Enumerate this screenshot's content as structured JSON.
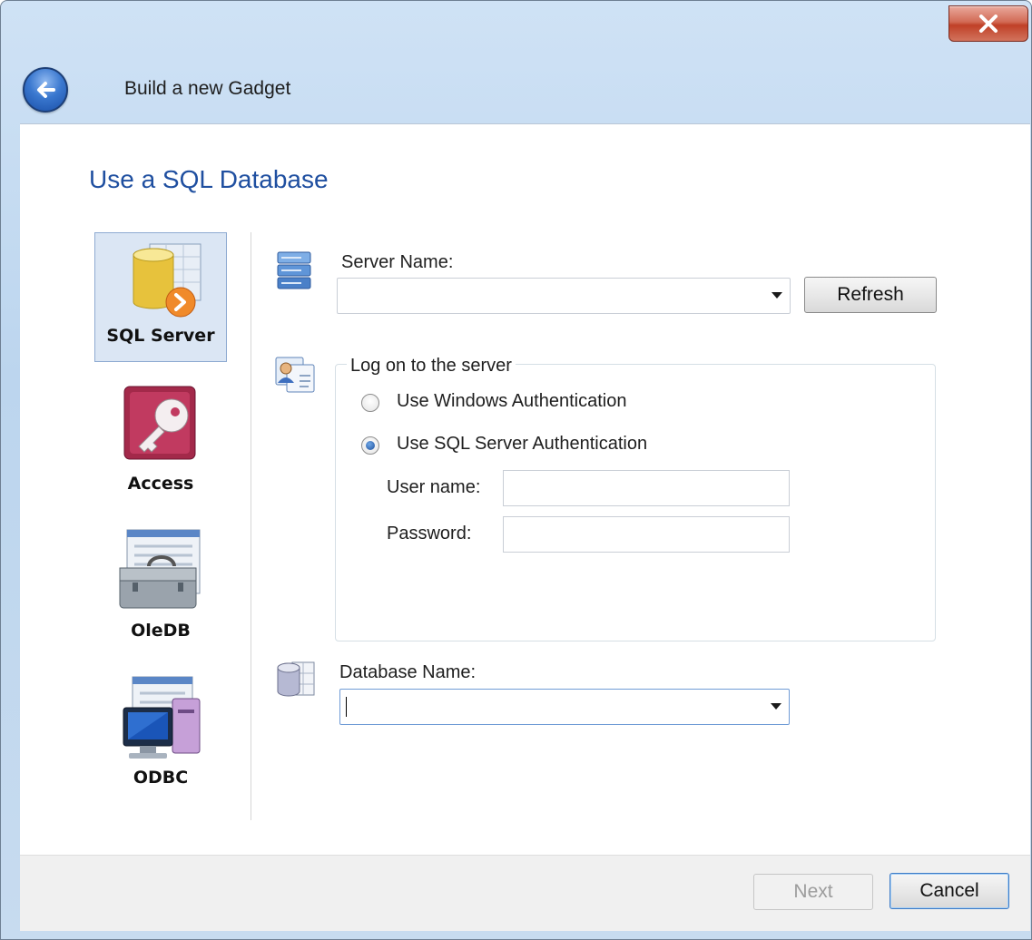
{
  "window": {
    "title": "Build a new Gadget",
    "close_glyph": "✕"
  },
  "page": {
    "heading": "Use a SQL Database"
  },
  "sources": [
    {
      "label": "SQL Server",
      "icon": "sql-server-icon",
      "selected": true
    },
    {
      "label": "Access",
      "icon": "access-key-icon",
      "selected": false
    },
    {
      "label": "OleDB",
      "icon": "toolbox-icon",
      "selected": false
    },
    {
      "label": "ODBC",
      "icon": "computer-icon",
      "selected": false
    }
  ],
  "server": {
    "label": "Server Name:",
    "value": "",
    "refresh_label": "Refresh",
    "icon": "server-stack-icon"
  },
  "logon": {
    "legend": "Log on to the server",
    "icon": "user-cards-icon",
    "windows_auth_label": "Use Windows Authentication",
    "sql_auth_label": "Use SQL Server Authentication",
    "selected": "sql",
    "username_label": "User name:",
    "username_value": "",
    "password_label": "Password:",
    "password_value": ""
  },
  "database": {
    "label": "Database Name:",
    "value": "",
    "icon": "database-table-icon"
  },
  "footer": {
    "next_label": "Next",
    "cancel_label": "Cancel"
  },
  "colors": {
    "heading": "#1f4fa0",
    "selection_bg": "#dbe6f4",
    "close_button": "#c04027"
  }
}
